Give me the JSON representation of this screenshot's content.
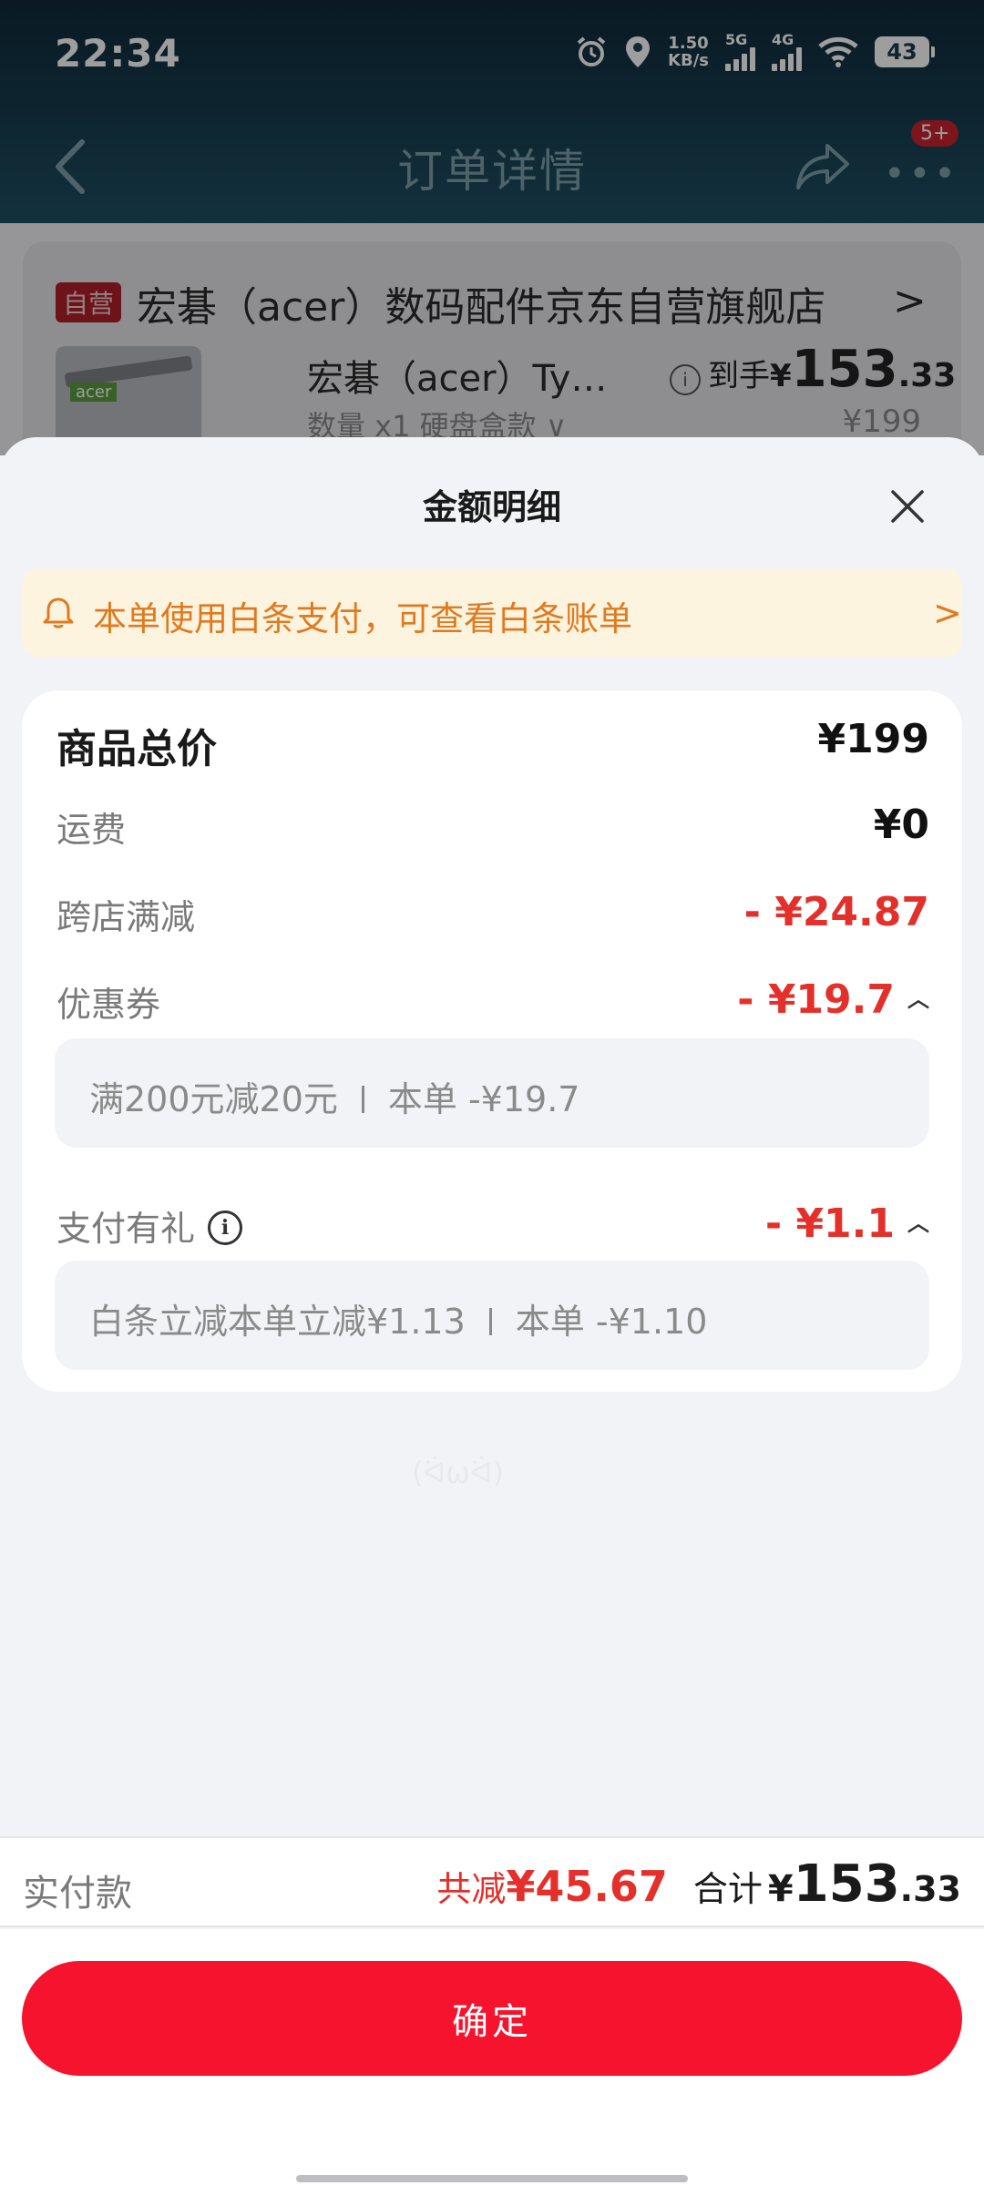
{
  "status_bar": {
    "time": "22:34",
    "net_speed": "1.50",
    "net_unit": "KB/s",
    "sim1": "5G",
    "sim2": "4G",
    "battery": "43"
  },
  "nav": {
    "title": "订单详情",
    "badge": "5+"
  },
  "store": {
    "tag": "自营",
    "name": "宏碁（acer）数码配件京东自营旗舰店",
    "chevron": ">"
  },
  "product": {
    "title": "宏碁（acer）Ty…",
    "price_label": "到手",
    "price_currency": "¥",
    "price_int": "153",
    "price_dec": ".33",
    "meta": "数量 x1  硬盘盒款  ∨",
    "original_price": "¥199",
    "image_logo": "acer"
  },
  "sheet": {
    "title": "金额明细",
    "notice": "本单使用白条支付，可查看白条账单",
    "notice_chevron": ">",
    "rows": {
      "total": {
        "label": "商品总价",
        "value": "¥199"
      },
      "shipping": {
        "label": "运费",
        "value": "¥0"
      },
      "cross_store": {
        "label": "跨店满减",
        "value": "- ¥24.87"
      },
      "coupon": {
        "label": "优惠券",
        "value": "- ¥19.7",
        "detail_left": "满200元减20元",
        "detail_right": "本单 -¥19.7"
      },
      "pay_gift": {
        "label": "支付有礼",
        "value": "- ¥1.1",
        "detail_left": "白条立减本单立减¥1.13",
        "detail_right": "本单 -¥1.10"
      }
    },
    "watermark": "(ᐛωᐛ)"
  },
  "pay_bar": {
    "label": "实付款",
    "reduce_label": "共减",
    "reduce_value": "¥45.67",
    "total_label": "合计",
    "total_currency": "¥",
    "total_int": "153",
    "total_dec": ".33"
  },
  "confirm": {
    "label": "确定"
  },
  "colors": {
    "accent_red": "#f5132d",
    "discount_red": "#e4302a",
    "notice_orange": "#e07a1f",
    "notice_bg": "#fdf4e0"
  }
}
